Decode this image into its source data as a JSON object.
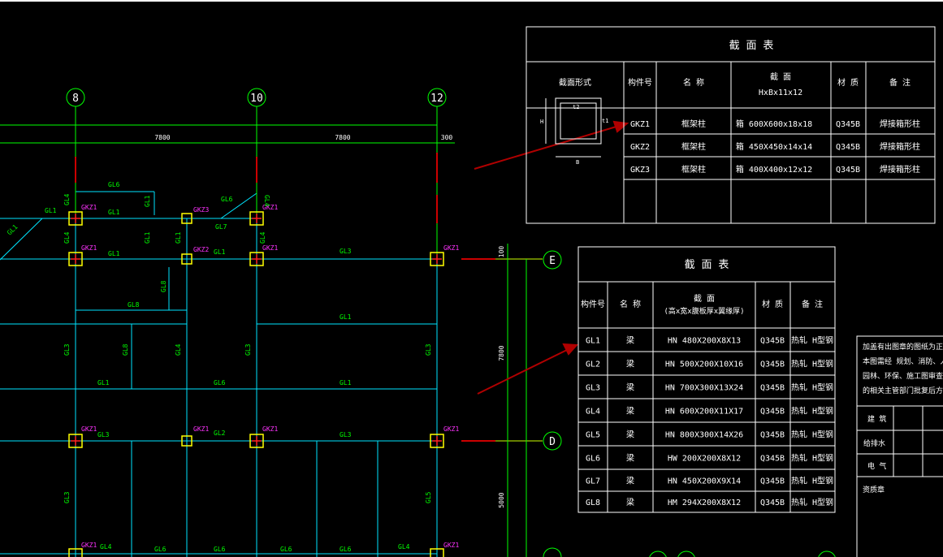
{
  "axes": {
    "c8": "8",
    "c10": "10",
    "c12": "12",
    "rE": "E",
    "rD": "D"
  },
  "dims": {
    "d1": "7800",
    "d2": "7800",
    "d3": "300",
    "v1": "100",
    "v2": "7800",
    "v3": "5000"
  },
  "labels": {
    "gkz1": "GKZ1",
    "gkz2": "GKZ2",
    "gkz3": "GKZ3",
    "gl1": "GL1",
    "gl2": "GL2",
    "gl3": "GL3",
    "gl4": "GL4",
    "gl5": "GL5",
    "gl6": "GL6",
    "gl7": "GL7",
    "gl8": "GL8"
  },
  "colors": {
    "grid": "#00e5ff",
    "beam": "#00ff00",
    "column": "#ffff00",
    "columnLabel": "#ff33ff",
    "axisLine": "#cc0000",
    "table": "#ffffff",
    "arrow": "#b00000"
  },
  "column_table": {
    "title": "截 面 表",
    "h_shape": "截面形式",
    "h_id": "构件号",
    "h_name": "名 称",
    "h_sec1": "截 面",
    "h_sec2": "HxBx11x12",
    "h_mat": "材 质",
    "h_note": "备 注",
    "rows": [
      {
        "id": "GKZ1",
        "name": "框架柱",
        "sec": "箱 600X600x18x18",
        "mat": "Q345B",
        "note": "焊接箱形柱"
      },
      {
        "id": "GKZ2",
        "name": "框架柱",
        "sec": "箱 450X450x14x14",
        "mat": "Q345B",
        "note": "焊接箱形柱"
      },
      {
        "id": "GKZ3",
        "name": "框架柱",
        "sec": "箱 400X400x12x12",
        "mat": "Q345B",
        "note": "焊接箱形柱"
      }
    ],
    "dim_h": "H",
    "dim_b": "B",
    "dim_t1": "t1",
    "dim_t2": "t2"
  },
  "beam_table": {
    "title": "截 面 表",
    "h_id": "构件号",
    "h_name": "名 称",
    "h_sec1": "截 面",
    "h_sec2": "(高x宽x腹板厚x翼缘厚)",
    "h_mat": "材 质",
    "h_note": "备 注",
    "rows": [
      {
        "id": "GL1",
        "name": "梁",
        "sec": "HN 480X200X8X13",
        "mat": "Q345B",
        "note": "热轧 H型钢"
      },
      {
        "id": "GL2",
        "name": "梁",
        "sec": "HN 500X200X10X16",
        "mat": "Q345B",
        "note": "热轧 H型钢"
      },
      {
        "id": "GL3",
        "name": "梁",
        "sec": "HN 700X300X13X24",
        "mat": "Q345B",
        "note": "热轧 H型钢"
      },
      {
        "id": "GL4",
        "name": "梁",
        "sec": "HN 600X200X11X17",
        "mat": "Q345B",
        "note": "热轧 H型钢"
      },
      {
        "id": "GL5",
        "name": "梁",
        "sec": "HN 800X300X14X26",
        "mat": "Q345B",
        "note": "热轧 H型钢"
      },
      {
        "id": "GL6",
        "name": "梁",
        "sec": "HW 200X200X8X12",
        "mat": "Q345B",
        "note": "热轧 H型钢"
      },
      {
        "id": "GL7",
        "name": "梁",
        "sec": "HN 450X200X9X14",
        "mat": "Q345B",
        "note": "热轧 H型钢"
      },
      {
        "id": "GL8",
        "name": "梁",
        "sec": "HM 294X200X8X12",
        "mat": "Q345B",
        "note": "热轧 H型钢"
      }
    ]
  },
  "title_block": {
    "note1": "加盖有出图章的图纸为正式施工",
    "note2": "本图需经  规划、消防、人防、",
    "note3": "园林、环保、施工图审查等部门",
    "note4": "的相关主管部门批复后方可施工",
    "row1": "建 筑",
    "row2": "给排水",
    "row3": "电 气",
    "row4": "资质章"
  }
}
